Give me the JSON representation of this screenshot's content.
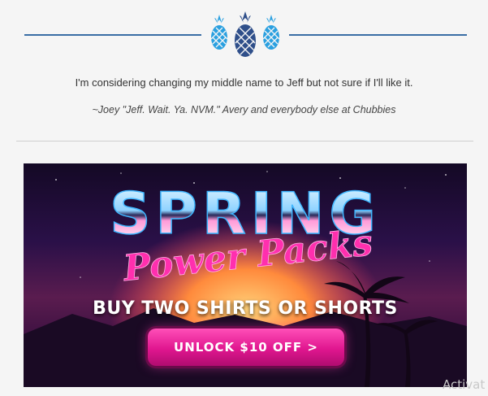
{
  "header": {
    "logo_icon": "pineapple-trio-icon",
    "colors": {
      "rule": "#3a6ea5",
      "pineapple_light": "#2aa0e0",
      "pineapple_dark": "#2f4f8a"
    }
  },
  "quote": {
    "text": "I'm considering changing my middle name to Jeff but not sure if I'll like it.",
    "attribution": "~Joey \"Jeff. Wait. Ya. NVM.\" Avery and everybody else at Chubbies"
  },
  "banner": {
    "title": "SPRING",
    "subtitle": "Power Packs",
    "headline": "BUY TWO SHIRTS OR SHORTS",
    "cta_label": "UNLOCK $10 OFF >",
    "colors": {
      "title_chrome": "#bfe6ff",
      "script_pink": "#ff2fae",
      "cta": "#e0168f"
    }
  },
  "watermark": {
    "text": "Activat"
  }
}
